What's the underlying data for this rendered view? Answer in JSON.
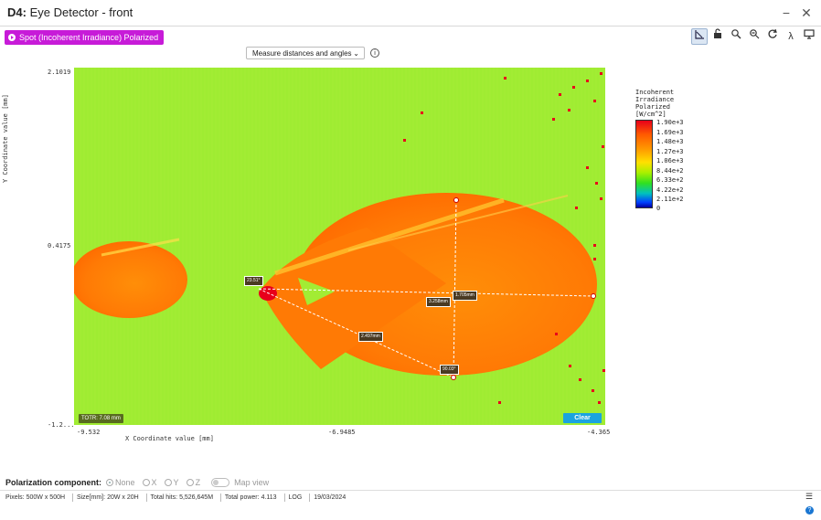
{
  "window": {
    "prefix": "D4:",
    "title": "Eye Detector - front",
    "minimize": "−",
    "close": "✕"
  },
  "chip": {
    "label": "Spot (Incoherent Irradiance) Polarized"
  },
  "toolbar": {
    "icons": [
      "axes-icon",
      "lock-icon",
      "zoom-in-icon",
      "zoom-out-icon",
      "refresh-icon",
      "lambda-icon",
      "monitor-icon"
    ],
    "lambda": "λ"
  },
  "measure": {
    "selected": "Measure distances and angles",
    "info": "i"
  },
  "axes": {
    "ylabel": "Y Coordinate value [mm]",
    "xlabel": "X Coordinate value [mm]",
    "yticks": [
      "2.1019",
      "0.4175",
      "-1.2..."
    ],
    "xticks": [
      "-9.532",
      "-6.9485",
      "-4.365"
    ]
  },
  "legend": {
    "title_lines": [
      "Incoherent",
      "Irradiance",
      "Polarized",
      "[W/cm^2]"
    ],
    "values": [
      "1.90e+3",
      "1.69e+3",
      "1.48e+3",
      "1.27e+3",
      "1.06e+3",
      "8.44e+2",
      "6.33e+2",
      "4.22e+2",
      "2.11e+2",
      "0"
    ],
    "colors": {
      "max": "#e8001a",
      "mid": "#ffe000",
      "low": "#30e020",
      "min": "#0000a0"
    }
  },
  "measurements": {
    "angle1": "23.51°",
    "dist1": "3.258mm",
    "dist2": "1.705mm",
    "dist3": "2.497mm",
    "angle2": "90.03°"
  },
  "plot": {
    "totr": "TOTR: 7.08 mm",
    "clear": "Clear"
  },
  "polarization": {
    "label": "Polarization component:",
    "options": [
      "None",
      "X",
      "Y",
      "Z"
    ],
    "selected": "None",
    "map_view": "Map view"
  },
  "status": {
    "pixels_label": "Pixels:",
    "pixels": "500W x 500H",
    "size_label": "Size[mm]:",
    "size": "20W x 20H",
    "hits_label": "Total hits:",
    "hits": "5,526,645M",
    "power_label": "Total power:",
    "power": "4.113",
    "log": "LOG",
    "date": "19/03/2024"
  }
}
